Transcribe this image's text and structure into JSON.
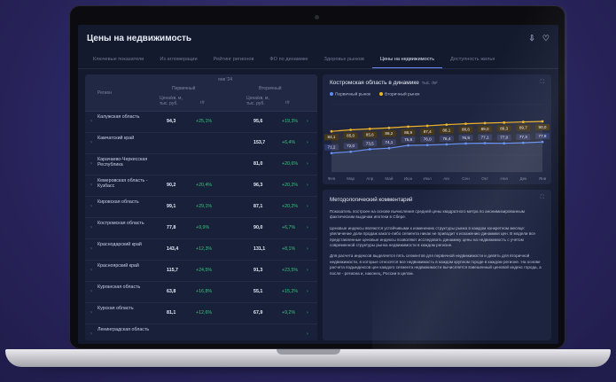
{
  "app": {
    "title": "Цены на недвижимость"
  },
  "tabs": [
    {
      "label": "Ключевые показатели"
    },
    {
      "label": "Из агломерации"
    },
    {
      "label": "Рейтинг регионов"
    },
    {
      "label": "ФО по динамике"
    },
    {
      "label": "Здоровье рынков"
    },
    {
      "label": "Цены на недвижимость"
    },
    {
      "label": "Доступность жилья"
    }
  ],
  "table": {
    "header": {
      "region": "Регион",
      "period": "янв '24",
      "primary": "Первичный",
      "secondary": "Вторичный",
      "price_col": "Цена/кв. м, тыс. руб.",
      "change_col": "г/г"
    },
    "rows": [
      {
        "name": "Калужская область",
        "v1": "94,3",
        "c1": "+25,1%",
        "v2": "95,6",
        "c2": "+19,3%"
      },
      {
        "name": "Камчатский край",
        "v1": "",
        "c1": "",
        "v2": "153,7",
        "c2": "+6,4%"
      },
      {
        "name": "Карачаево-Черкесская Республика",
        "v1": "",
        "c1": "",
        "v2": "81,0",
        "c2": "+20,6%"
      },
      {
        "name": "Кемеровская область - Кузбасс",
        "v1": "90,2",
        "c1": "+20,4%",
        "v2": "96,3",
        "c2": "+20,2%"
      },
      {
        "name": "Кировская область",
        "v1": "99,1",
        "c1": "+29,1%",
        "v2": "87,1",
        "c2": "+20,2%"
      },
      {
        "name": "Костромская область",
        "v1": "77,8",
        "c1": "+9,9%",
        "v2": "90,0",
        "c2": "+6,7%"
      },
      {
        "name": "Краснодарский край",
        "v1": "143,4",
        "c1": "+12,3%",
        "v2": "131,1",
        "c2": "+8,1%"
      },
      {
        "name": "Красноярский край",
        "v1": "115,7",
        "c1": "+24,5%",
        "v2": "91,3",
        "c2": "+23,5%"
      },
      {
        "name": "Курганская область",
        "v1": "63,8",
        "c1": "+16,8%",
        "v2": "55,1",
        "c2": "+15,2%"
      },
      {
        "name": "Курская область",
        "v1": "81,1",
        "c1": "+12,6%",
        "v2": "67,9",
        "c2": "+9,2%"
      },
      {
        "name": "Ленинградская область",
        "v1": "",
        "c1": "",
        "v2": "",
        "c2": ""
      }
    ]
  },
  "chart_panel": {
    "title": "Костромская область в динамике",
    "unit": "тыс. /м²",
    "legend": [
      {
        "name": "Первичный рынок",
        "color": "#5b8cff"
      },
      {
        "name": "Вторичный рынок",
        "color": "#f0b428"
      }
    ]
  },
  "chart_data": {
    "type": "line",
    "title": "Костромская область в динамике",
    "x": [
      "Фев",
      "Мар",
      "Апр",
      "Май",
      "Июн",
      "Июл",
      "Авг",
      "Сен",
      "Окт",
      "Ноя",
      "Дек",
      "Янв"
    ],
    "series": [
      {
        "name": "Первичный рынок",
        "color": "#5b8cff",
        "values": [
          71.2,
          72.0,
          73.5,
          74.1,
          75.8,
          76.0,
          76.4,
          76.9,
          77.1,
          77.0,
          77.3,
          77.8
        ]
      },
      {
        "name": "Вторичный рынок",
        "color": "#f0b428",
        "values": [
          84.1,
          85.0,
          85.6,
          86.2,
          86.9,
          87.4,
          88.1,
          88.6,
          89.0,
          89.3,
          89.7,
          90.0
        ]
      }
    ]
  },
  "comment": {
    "title": "Методологический комментарий",
    "paragraphs": [
      "Показатель построен на основе вычисления средней цены квадратного метра по анонимизированным фактическим выдачам ипотеки в Сбере.",
      "Ценовые индексы являются устойчивыми к изменению структуры рынка в каждом конкретном месяце: увеличение доли продаж какого-либо сегмента никак не приводит к искажению динамики цен. В модели все представленные ценовые индексы позволяют исследовать динамику цены на недвижимость с учетом современной структуры рынка недвижимости в каждом регионе.",
      "Для расчета индексов выделяется пять сегментов для первичной недвижимости и девять для вторичной недвижимости, в которые относятся все недвижимость в каждом крупном городе в каждом регионе. На основе расчета подындексов цен каждого сегмента недвижимости вычисляется взвешенный ценовой индекс города, а после - региона и, наконец, России в целом."
    ]
  }
}
